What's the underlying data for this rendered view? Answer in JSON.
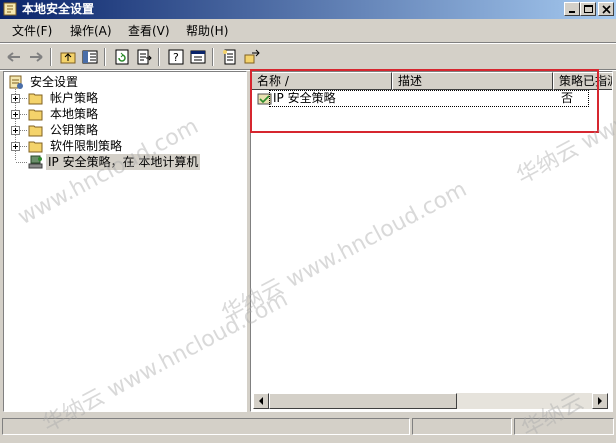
{
  "window": {
    "title": "本地安全设置",
    "controls": [
      "minimize",
      "maximize",
      "close"
    ]
  },
  "menu": [
    {
      "label": "文件(F)"
    },
    {
      "label": "操作(A)"
    },
    {
      "label": "查看(V)"
    },
    {
      "label": "帮助(H)"
    }
  ],
  "toolbar": {
    "buttons": [
      "back-icon",
      "forward-icon",
      "up-folder-icon",
      "show-hide-tree-icon",
      "refresh-icon",
      "export-list-icon",
      "help-icon",
      "properties-icon",
      "new-policy-icon",
      "manage-filters-icon"
    ]
  },
  "tree": {
    "root": {
      "label": "安全设置",
      "icon": "security-settings-icon"
    },
    "items": [
      {
        "label": "帐户策略",
        "icon": "folder-icon",
        "expandable": true
      },
      {
        "label": "本地策略",
        "icon": "folder-icon",
        "expandable": true
      },
      {
        "label": "公钥策略",
        "icon": "folder-icon",
        "expandable": true
      },
      {
        "label": "软件限制策略",
        "icon": "folder-icon",
        "expandable": true
      },
      {
        "label": "IP 安全策略，在 本地计算机",
        "icon": "ip-security-icon",
        "expandable": false,
        "selected": true
      }
    ]
  },
  "list": {
    "columns": [
      "名称 /",
      "描述",
      "策略已指派"
    ],
    "rows": [
      {
        "name": "IP 安全策略",
        "description": "",
        "assigned": "否",
        "icon": "policy-icon"
      }
    ]
  },
  "watermarks": [
    "www.hncloud.com",
    "华纳云 www.hncloud.com",
    "华纳云 www.hncloud.com",
    "华纳云 www.",
    "华纳云"
  ],
  "colors": {
    "titlebar_start": "#0a246a",
    "titlebar_end": "#a6caf0",
    "highlight_box": "#d6262f",
    "window_face": "#d4d0c8"
  }
}
